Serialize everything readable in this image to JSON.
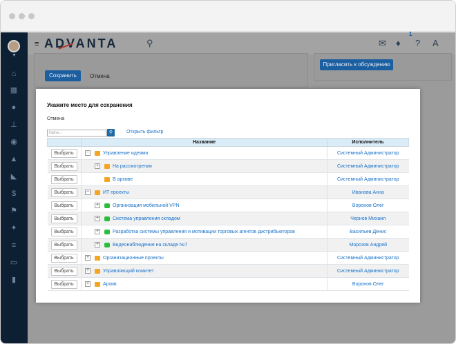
{
  "header": {
    "logo_text": "ADVANTA",
    "notification_count": "1",
    "profile_initial": "A"
  },
  "panels": {
    "save_label": "Сохранить",
    "cancel_label": "Отмена",
    "invite_label": "Пригласить к обсуждению"
  },
  "modal": {
    "title": "Укажите место для сохранения",
    "cancel_label": "Отмена",
    "search_placeholder": "Найти...",
    "filter_link": "Открыть фильтр",
    "columns": [
      "Название",
      "Исполнитель"
    ],
    "select_label": "Выбрать",
    "rows": [
      {
        "name": "Управление идеями",
        "executor": "Системный Администратор",
        "type": "folder",
        "level": 0,
        "toggle": "−"
      },
      {
        "name": "На рассмотрении",
        "executor": "Системный Администратор",
        "type": "folder",
        "level": 1,
        "toggle": "+"
      },
      {
        "name": "В архиве",
        "executor": "Системный Администратор",
        "type": "folder",
        "level": 1,
        "toggle": ""
      },
      {
        "name": "ИТ проекты",
        "executor": "Иванова Анна",
        "type": "folder",
        "level": 0,
        "toggle": "−"
      },
      {
        "name": "Организация мобильной VPN",
        "executor": "Воронов Олег",
        "type": "project",
        "level": 1,
        "toggle": "+"
      },
      {
        "name": "Система управления складом",
        "executor": "Чернов Михаил",
        "type": "project",
        "level": 1,
        "toggle": "+"
      },
      {
        "name": "Разработка системы управления и мотивации торговых агентов дистрибьюторов",
        "executor": "Васильев Денис",
        "type": "project",
        "level": 1,
        "toggle": "+"
      },
      {
        "name": "Видеонаблюдение на складе №7",
        "executor": "Морозов Андрей",
        "type": "project",
        "level": 1,
        "toggle": "+"
      },
      {
        "name": "Организационные проекты",
        "executor": "Системный Администратор",
        "type": "folder",
        "level": 0,
        "toggle": "+"
      },
      {
        "name": "Управляющий комитет",
        "executor": "Системный Администратор",
        "type": "folder",
        "level": 0,
        "toggle": "+"
      },
      {
        "name": "Архив",
        "executor": "Воронов Олег",
        "type": "folder",
        "level": 0,
        "toggle": "+"
      }
    ]
  },
  "colors": {
    "sidebar": "#0d1f33",
    "primary": "#1c5fa1",
    "link": "#1a73c9",
    "folder": "#f4a622",
    "project": "#2ebc3e"
  }
}
